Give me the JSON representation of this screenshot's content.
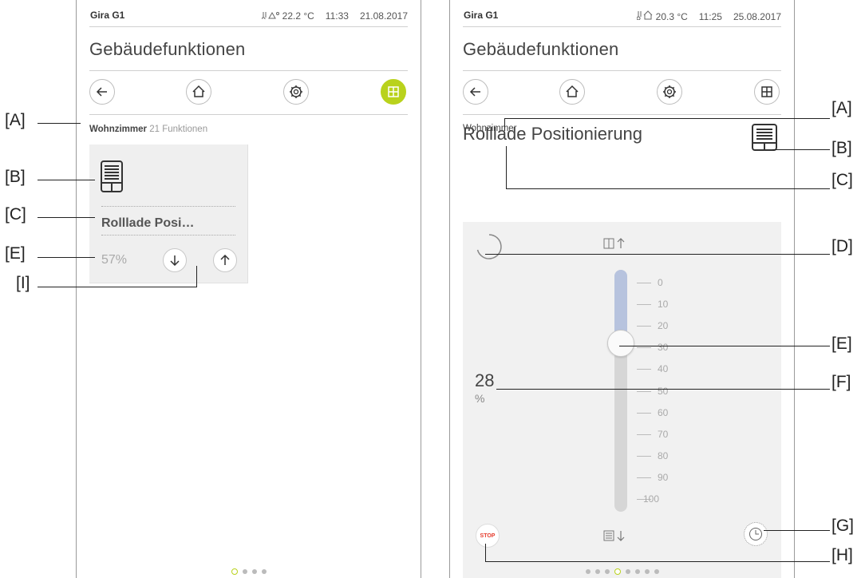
{
  "left": {
    "app_name": "Gira G1",
    "weather_glyph": "ИΔº",
    "temp": "22.2 °C",
    "time": "11:33",
    "date": "21.08.2017",
    "page_title": "Gebäudefunktionen",
    "room": "Wohnzimmer",
    "count": "21",
    "count_label": "Funktionen",
    "tile": {
      "name": "Rolllade Posi…",
      "value": "57%",
      "icon": "roller-shutter-icon"
    },
    "pager_pages": 4,
    "pager_current": 0
  },
  "right": {
    "app_name": "Gira G1",
    "temp": "20.3 °C",
    "time": "11:25",
    "date": "25.08.2017",
    "page_title": "Gebäudefunktionen",
    "room": "Wohnzimmer",
    "function_name": "Rolllade Positionierung",
    "scale": [
      "0",
      "10",
      "20",
      "30",
      "40",
      "50",
      "60",
      "70",
      "80",
      "90",
      "100"
    ],
    "position_value": "28",
    "position_unit": "%",
    "slider_position_fraction": 0.28,
    "stop_label": "STOP",
    "pager_pages": 8,
    "pager_current": 3
  },
  "annotations": {
    "A": "[A]",
    "B": "[B]",
    "C": "[C]",
    "D": "[D]",
    "E": "[E]",
    "F": "[F]",
    "G": "[G]",
    "H": "[H]",
    "I": "[I]"
  },
  "colors": {
    "accent": "#b9d21c",
    "slider_fill": "#b7c3de",
    "stop": "#e53b2c"
  }
}
